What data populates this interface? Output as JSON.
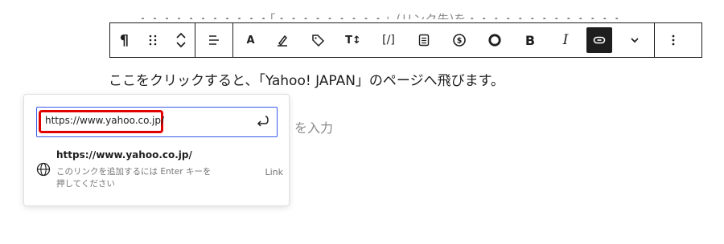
{
  "background": {
    "top_text": "・・・・・・・・・・・「・・・・・・・・・」(リンク先)を・・・・・・・・・・・・・",
    "paragraph": "ここをクリックすると、「Yahoo! JAPAN」のページへ飛びます。",
    "placeholder_fragment": "を入力"
  },
  "toolbar": {
    "paragraph_icon": "¶",
    "drag_icon": "⠿",
    "bold": "B",
    "italic": "I",
    "text_color": "A",
    "font_size": "T↕",
    "code": "[/]",
    "accent_active": "#1e1e1e"
  },
  "link_popover": {
    "input_value": "https://www.yahoo.co.jp/",
    "suggestion_title": "https://www.yahoo.co.jp/",
    "suggestion_desc": "このリンクを追加するには Enter キーを押してください",
    "suggestion_type": "Link",
    "focus_color": "#3858e9",
    "highlight_color": "#e00000"
  }
}
